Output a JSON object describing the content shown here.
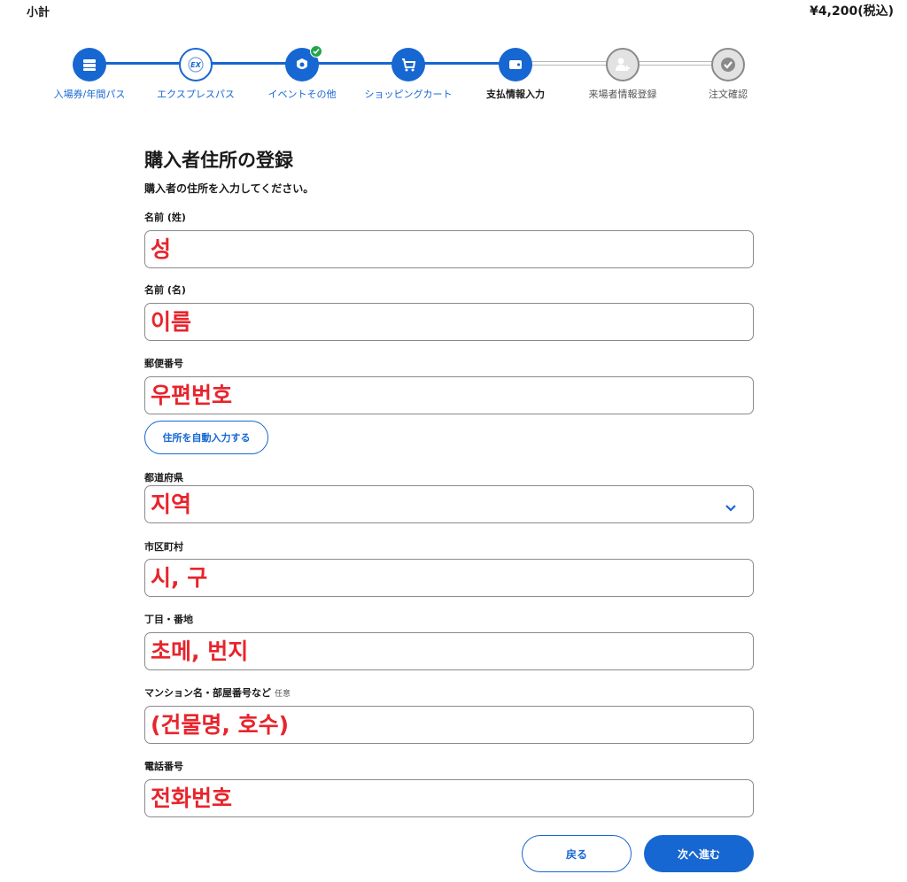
{
  "subtotal": {
    "label": "小計",
    "value": "¥4,200(税込)"
  },
  "steps": [
    {
      "label": "入場券/年間パス",
      "icon": "ticket-icon",
      "status": "done"
    },
    {
      "label": "エクスプレスパス",
      "icon": "express-pass-icon",
      "status": "outline"
    },
    {
      "label": "イベントその他",
      "icon": "event-icon",
      "status": "done"
    },
    {
      "label": "ショッピングカート",
      "icon": "cart-icon",
      "status": "done"
    },
    {
      "label": "支払情報入力",
      "icon": "wallet-icon",
      "status": "current"
    },
    {
      "label": "来場者情報登録",
      "icon": "add-user-icon",
      "status": "pending"
    },
    {
      "label": "注文確認",
      "icon": "check-icon",
      "status": "pending"
    }
  ],
  "form": {
    "title": "購入者住所の登録",
    "description": "購入者の住所を入力してください。",
    "fields": [
      {
        "label": "名前 (姓)",
        "value": "성"
      },
      {
        "label": "名前 (名)",
        "value": "이름"
      },
      {
        "label": "郵便番号",
        "value": "우편번호"
      },
      {
        "label": "都道府県",
        "value": "지역"
      },
      {
        "label": "市区町村",
        "value": "시, 구"
      },
      {
        "label": "丁目・番地",
        "value": "초메, 번지"
      },
      {
        "label": "マンション名・部屋番号など",
        "optional": "任意",
        "value": "(건물명, 호수)"
      },
      {
        "label": "電話番号",
        "value": "전화번호"
      }
    ],
    "auto_fill_label": "住所を自動入力する"
  },
  "buttons": {
    "back": "戻る",
    "next": "次へ進む"
  },
  "colors": {
    "primary": "#1767d2",
    "annotation": "#e8242c",
    "success": "#23a54a"
  }
}
